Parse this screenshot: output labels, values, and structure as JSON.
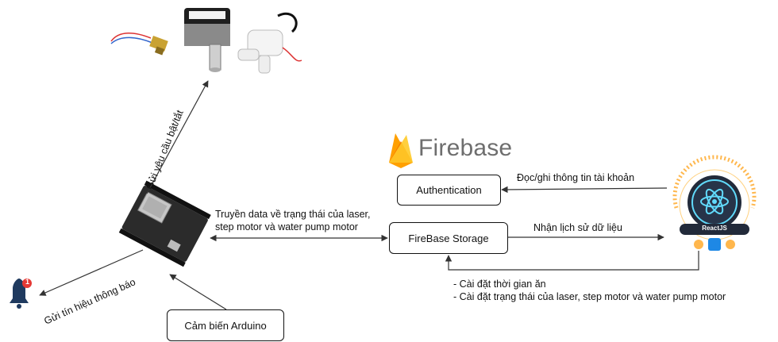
{
  "brand": {
    "firebase_name": "Firebase",
    "react_badge": "ReactJS"
  },
  "nodes": {
    "authentication": "Authentication",
    "storage": "FireBase Storage",
    "sensor": "Cảm biến Arduino",
    "notification_badge": "1"
  },
  "edges": {
    "board_to_actuators": "Gửi yêu cầu bật/tắt",
    "board_to_bell": "Gửi tín hiệu thông báo",
    "board_storage_line1": "Truyền data về trạng thái của laser,",
    "board_storage_line2": "step motor và water pump motor",
    "react_to_auth": "Đọc/ghi thông tin tài khoản",
    "storage_to_react": "Nhận lịch sử dữ liệu",
    "react_to_storage_line1": "- Cài đặt thời gian ăn",
    "react_to_storage_line2": "- Cài đặt trạng thái của laser, step motor và water pump motor"
  },
  "colors": {
    "line": "#333333",
    "firebase_yellow": "#FFCA28",
    "firebase_orange": "#F57C00",
    "firebase_amber": "#FFA000",
    "react_cyan": "#61DAFB",
    "react_dark": "#222a3a",
    "board_dark": "#2b2b2b",
    "bell_navy": "#1f3a5f",
    "badge_red": "#e53935"
  }
}
